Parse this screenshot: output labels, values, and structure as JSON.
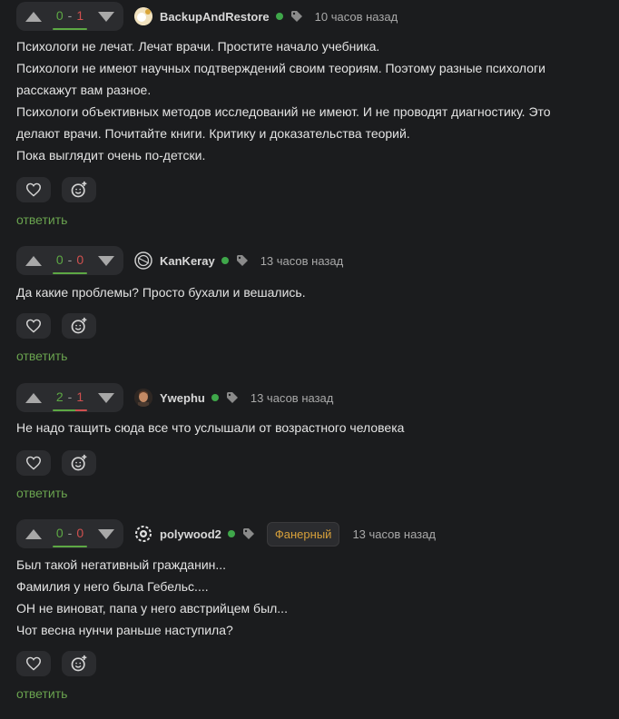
{
  "colors": {
    "background": "#1b1c1e",
    "accent_green": "#6aa34f",
    "plus": "#5da844",
    "minus": "#d0504f",
    "badge": "#d7a03a",
    "online": "#3fa74a"
  },
  "comments": [
    {
      "rating": {
        "plus": "0",
        "minus": "1"
      },
      "user": "BackupAndRestore",
      "time": "10 часов назад",
      "lines": [
        "Психологи не лечат. Лечат врачи. Простите начало учебника.",
        "Психологи не имеют научных подтверждений своим теориям. Поэтому разные психологи",
        "расскажут вам разное.",
        "Психологи объективных методов исследований не имеют. И не проводят диагностику. Это",
        "делают врачи. Почитайте книги. Критику и доказательства теорий.",
        "Пока выглядит очень по-детски."
      ],
      "reply": "ответить"
    },
    {
      "rating": {
        "plus": "0",
        "minus": "0"
      },
      "user": "KanKeray",
      "time": "13 часов назад",
      "lines": [
        "Да какие проблемы? Просто бухали и вешались."
      ],
      "reply": "ответить"
    },
    {
      "rating": {
        "plus": "2",
        "minus": "1"
      },
      "user": "Ywephu",
      "time": "13 часов назад",
      "lines": [
        "Не надо тащить сюда все что услышали от возрастного человека"
      ],
      "reply": "ответить"
    },
    {
      "rating": {
        "plus": "0",
        "minus": "0"
      },
      "user": "polywood2",
      "badge": "Фанерный",
      "time": "13 часов назад",
      "lines": [
        "Был такой негативный гражданин...",
        "Фамилия у него была Гебельс....",
        "ОН не виноват, папа у него австрийцем был...",
        "Чот весна нунчи раньше наступила?"
      ],
      "reply": "ответить"
    }
  ]
}
